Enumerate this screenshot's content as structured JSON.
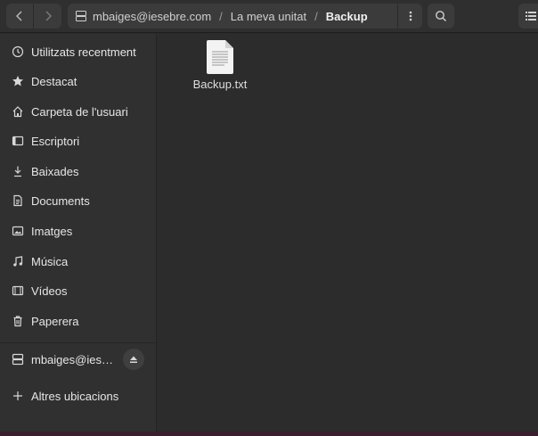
{
  "header": {
    "path": [
      "mbaiges@iesebre.com",
      "La meva unitat",
      "Backup"
    ],
    "path_separator": "/"
  },
  "sidebar": {
    "items": [
      {
        "label": "Utilitzats recentment",
        "icon": "clock-icon"
      },
      {
        "label": "Destacat",
        "icon": "star-icon"
      },
      {
        "label": "Carpeta de l'usuari",
        "icon": "home-icon"
      },
      {
        "label": "Escriptori",
        "icon": "desktop-icon"
      },
      {
        "label": "Baixades",
        "icon": "download-icon"
      },
      {
        "label": "Documents",
        "icon": "document-icon"
      },
      {
        "label": "Imatges",
        "icon": "image-icon"
      },
      {
        "label": "Música",
        "icon": "music-icon"
      },
      {
        "label": "Vídeos",
        "icon": "video-icon"
      },
      {
        "label": "Paperera",
        "icon": "trash-icon"
      }
    ],
    "mount": {
      "label": "mbaiges@ies…",
      "icon": "network-drive-icon"
    },
    "other_locations": {
      "label": "Altres ubicacions",
      "icon": "plus-icon"
    }
  },
  "content": {
    "files": [
      {
        "name": "Backup.txt",
        "icon": "text-file-icon"
      }
    ]
  },
  "colors": {
    "window_bg": "#2b2b2b",
    "sidebar_bg": "#303030",
    "header_bg": "#2f2f2f",
    "button_bg": "#3b3b3b",
    "text": "#e6e6e6"
  }
}
